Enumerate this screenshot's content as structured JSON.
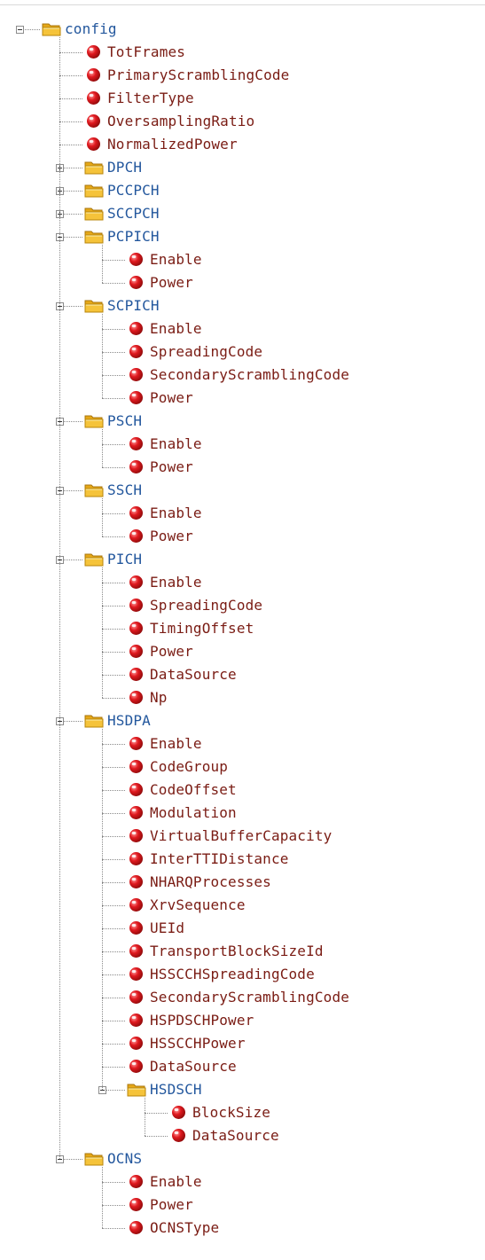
{
  "tree": {
    "label": "config",
    "type": "folder",
    "expanded": true,
    "children": [
      {
        "label": "TotFrames",
        "type": "leaf"
      },
      {
        "label": "PrimaryScramblingCode",
        "type": "leaf"
      },
      {
        "label": "FilterType",
        "type": "leaf"
      },
      {
        "label": "OversamplingRatio",
        "type": "leaf"
      },
      {
        "label": "NormalizedPower",
        "type": "leaf"
      },
      {
        "label": "DPCH",
        "type": "folder",
        "expanded": false,
        "children": []
      },
      {
        "label": "PCCPCH",
        "type": "folder",
        "expanded": false,
        "children": []
      },
      {
        "label": "SCCPCH",
        "type": "folder",
        "expanded": false,
        "children": []
      },
      {
        "label": "PCPICH",
        "type": "folder",
        "expanded": true,
        "children": [
          {
            "label": "Enable",
            "type": "leaf"
          },
          {
            "label": "Power",
            "type": "leaf"
          }
        ]
      },
      {
        "label": "SCPICH",
        "type": "folder",
        "expanded": true,
        "children": [
          {
            "label": "Enable",
            "type": "leaf"
          },
          {
            "label": "SpreadingCode",
            "type": "leaf"
          },
          {
            "label": "SecondaryScramblingCode",
            "type": "leaf"
          },
          {
            "label": "Power",
            "type": "leaf"
          }
        ]
      },
      {
        "label": "PSCH",
        "type": "folder",
        "expanded": true,
        "children": [
          {
            "label": "Enable",
            "type": "leaf"
          },
          {
            "label": "Power",
            "type": "leaf"
          }
        ]
      },
      {
        "label": "SSCH",
        "type": "folder",
        "expanded": true,
        "children": [
          {
            "label": "Enable",
            "type": "leaf"
          },
          {
            "label": "Power",
            "type": "leaf"
          }
        ]
      },
      {
        "label": "PICH",
        "type": "folder",
        "expanded": true,
        "children": [
          {
            "label": "Enable",
            "type": "leaf"
          },
          {
            "label": "SpreadingCode",
            "type": "leaf"
          },
          {
            "label": "TimingOffset",
            "type": "leaf"
          },
          {
            "label": "Power",
            "type": "leaf"
          },
          {
            "label": "DataSource",
            "type": "leaf"
          },
          {
            "label": "Np",
            "type": "leaf"
          }
        ]
      },
      {
        "label": "HSDPA",
        "type": "folder",
        "expanded": true,
        "children": [
          {
            "label": "Enable",
            "type": "leaf"
          },
          {
            "label": "CodeGroup",
            "type": "leaf"
          },
          {
            "label": "CodeOffset",
            "type": "leaf"
          },
          {
            "label": "Modulation",
            "type": "leaf"
          },
          {
            "label": "VirtualBufferCapacity",
            "type": "leaf"
          },
          {
            "label": "InterTTIDistance",
            "type": "leaf"
          },
          {
            "label": "NHARQProcesses",
            "type": "leaf"
          },
          {
            "label": "XrvSequence",
            "type": "leaf"
          },
          {
            "label": "UEId",
            "type": "leaf"
          },
          {
            "label": "TransportBlockSizeId",
            "type": "leaf"
          },
          {
            "label": "HSSCCHSpreadingCode",
            "type": "leaf"
          },
          {
            "label": "SecondaryScramblingCode",
            "type": "leaf"
          },
          {
            "label": "HSPDSCHPower",
            "type": "leaf"
          },
          {
            "label": "HSSCCHPower",
            "type": "leaf"
          },
          {
            "label": "DataSource",
            "type": "leaf"
          },
          {
            "label": "HSDSCH",
            "type": "folder",
            "expanded": true,
            "children": [
              {
                "label": "BlockSize",
                "type": "leaf"
              },
              {
                "label": "DataSource",
                "type": "leaf"
              }
            ]
          }
        ]
      },
      {
        "label": "OCNS",
        "type": "folder",
        "expanded": true,
        "children": [
          {
            "label": "Enable",
            "type": "leaf"
          },
          {
            "label": "Power",
            "type": "leaf"
          },
          {
            "label": "OCNSType",
            "type": "leaf"
          }
        ]
      }
    ]
  },
  "colors": {
    "folder_label": "#23579d",
    "leaf_label": "#7a1c14",
    "connector": "#8a8a8a",
    "leaf_icon": "#e0191f",
    "folder_icon": "#f5c33a"
  },
  "icons": {
    "folder": "folder-icon",
    "leaf": "red-ball-icon",
    "expand": "plus-icon",
    "collapse": "minus-icon"
  }
}
